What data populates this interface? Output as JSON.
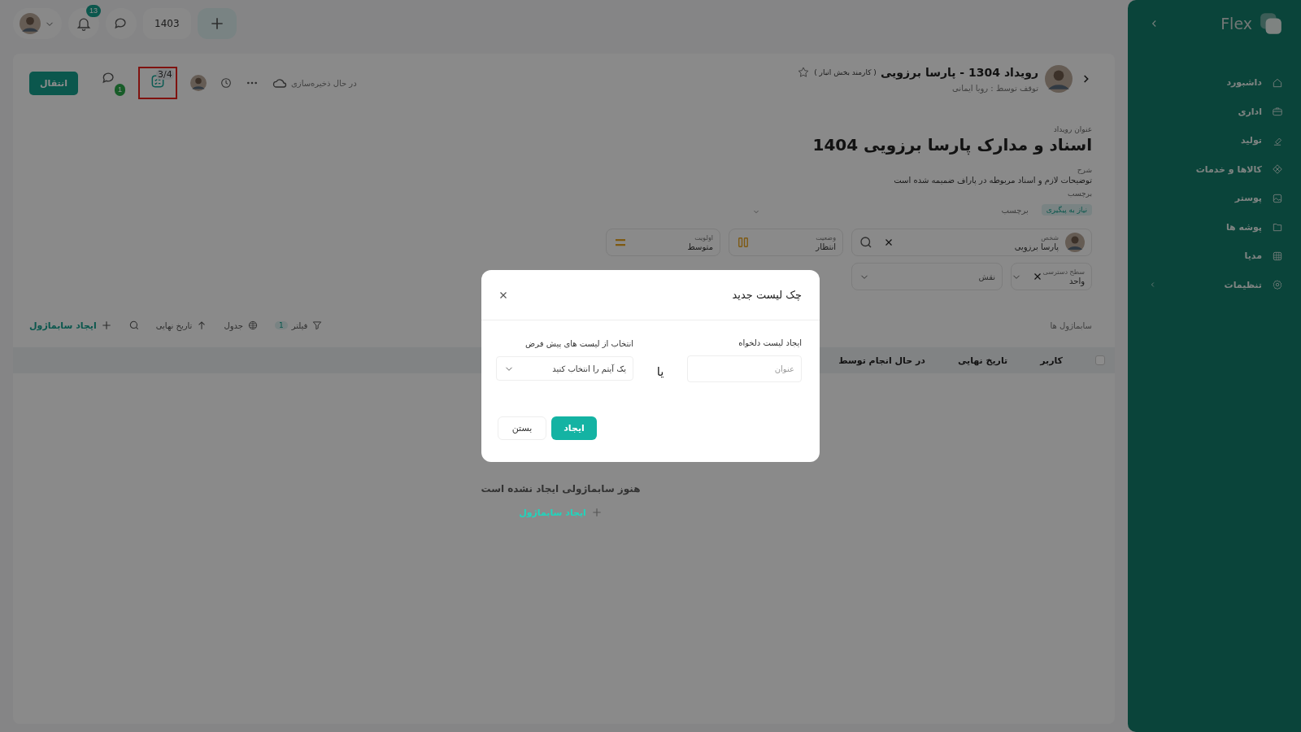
{
  "topbar": {
    "notifications_count": "13",
    "year": "1403"
  },
  "toolbar": {
    "transfer_button": "انتقال",
    "comments_count": "1",
    "checklist_progress": "3/4",
    "checklist_highlighted": true,
    "saving_status": "در حال ذخیره‌سازی"
  },
  "event": {
    "title": "رویداد 1304 - پارسا برزویی",
    "role": "( کارمند بخش انبار )",
    "starred": false,
    "stopped_by": "توقف توسط : رویا ایمانی"
  },
  "details": {
    "title_label": "عنوان رویداد",
    "title": "اسناد و مدارک پارسا برزویی 1404",
    "description_label": "شرح",
    "description": "توضیحات لازم و اسناد مربوطه در پاراف ضمیمه شده است",
    "tags_label": "برچسب",
    "tags": [
      {
        "kind": "tag",
        "label": "نیاز به پیگیری"
      },
      {
        "kind": "hint",
        "label": "برچسب"
      }
    ]
  },
  "fields": [
    {
      "kind": "person",
      "label": "شخص",
      "value": "پارسا برزویی"
    },
    {
      "kind": "status",
      "label": "وضعیت",
      "value": "انتظار"
    },
    {
      "kind": "priority",
      "label": "اولویت",
      "value": "متوسط"
    }
  ],
  "access_fields": [
    {
      "kind": "access",
      "label": "سطح دسترسی",
      "value": "واحد"
    },
    {
      "kind": "select",
      "placeholder": "نقش"
    }
  ],
  "submodules": {
    "heading": "سابماژول ها",
    "filter": "فیلتر",
    "filter_count": "1",
    "view": "جدول",
    "sort": "تاریخ نهایی",
    "create": "ایجاد سابماژول",
    "select_all_checked": false,
    "columns": [
      "کاربر",
      "تاریخ نهایی",
      "در حال انجام توسط"
    ],
    "empty_text": "هنوز سابماژولی ایجاد نشده است",
    "empty_create": "ایجاد سابماژول"
  },
  "sidebar": {
    "brand": "Flex",
    "items": [
      {
        "kind": "home",
        "label": "داشبورد"
      },
      {
        "kind": "briefcase",
        "label": "اداری"
      },
      {
        "kind": "eraser",
        "label": "تولید"
      },
      {
        "kind": "diamond",
        "label": "کالاها و خدمات"
      },
      {
        "kind": "image",
        "label": "پوستر"
      },
      {
        "kind": "folder",
        "label": "پوشه ها"
      },
      {
        "kind": "grid",
        "label": "مدیا"
      },
      {
        "kind": "gear",
        "label": "تنظیمات",
        "expandable": true
      }
    ]
  },
  "modal": {
    "title": "چک لیست جدید",
    "custom_label": "ایجاد لیست دلخواه",
    "custom_placeholder": "عنوان",
    "or": "یا",
    "preset_label": "انتخاب از لیست های پیش فرض",
    "preset_placeholder": "یک آیتم را انتخاب کنید",
    "buttons": [
      {
        "kind": "primary",
        "label": "ایجاد"
      },
      {
        "kind": "secondary",
        "label": "بستن"
      }
    ]
  }
}
